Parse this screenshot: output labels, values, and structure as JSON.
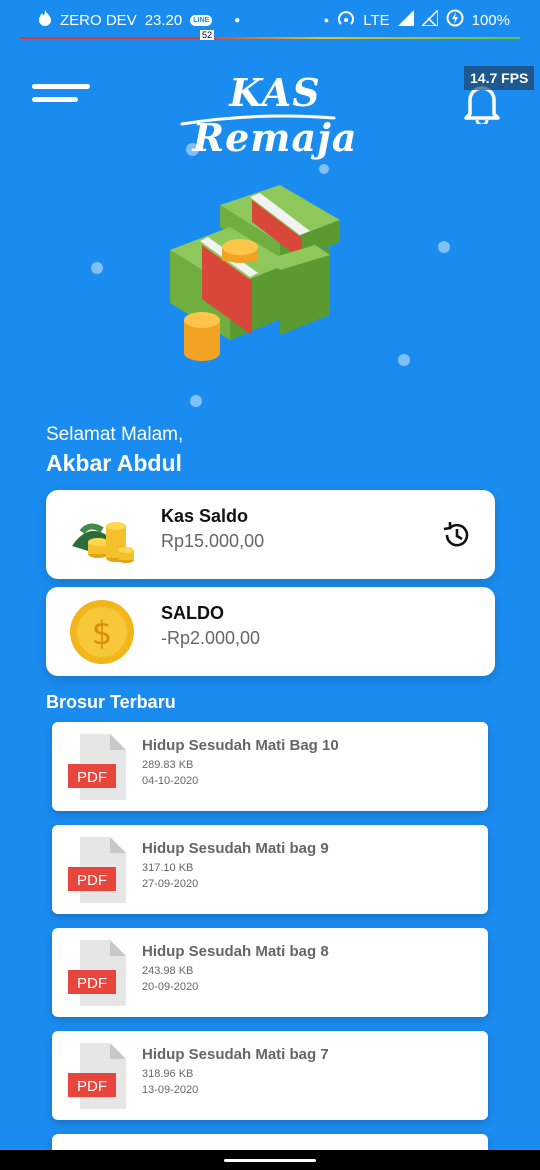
{
  "status_bar": {
    "carrier": "ZERO DEV",
    "time": "23.20",
    "line_badge": "LINE",
    "notification_count": "52",
    "network": "LTE",
    "battery": "100%"
  },
  "header": {
    "logo_text": "KAS Remaja",
    "fps": "14.7 FPS"
  },
  "greeting": {
    "salutation": "Selamat Malam,",
    "user_name": "Akbar Abdul"
  },
  "cards": [
    {
      "title": "Kas Saldo",
      "value": "Rp15.000,00"
    },
    {
      "title": "SALDO",
      "value": "-Rp2.000,00"
    }
  ],
  "section_title": "Brosur Terbaru",
  "brochures": [
    {
      "title": "Hidup Sesudah Mati Bag 10",
      "size": "289.83 KB",
      "date": "04-10-2020",
      "badge": "PDF"
    },
    {
      "title": "Hidup Sesudah Mati bag 9",
      "size": "317.10 KB",
      "date": "27-09-2020",
      "badge": "PDF"
    },
    {
      "title": "Hidup Sesudah Mati bag 8",
      "size": "243.98 KB",
      "date": "20-09-2020",
      "badge": "PDF"
    },
    {
      "title": "Hidup Sesudah Mati bag 7",
      "size": "318.96 KB",
      "date": "13-09-2020",
      "badge": "PDF"
    }
  ],
  "colors": {
    "background": "#1a8cf0",
    "pdf_red": "#e8453c"
  }
}
